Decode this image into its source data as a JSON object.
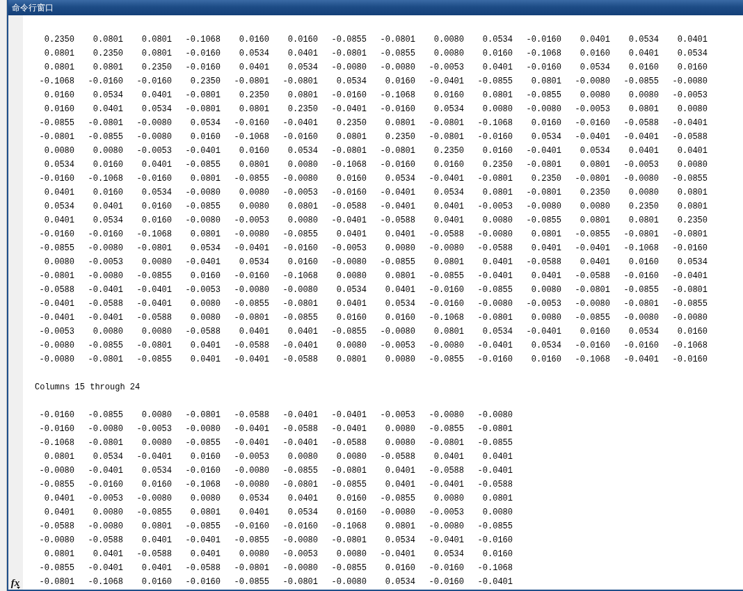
{
  "window": {
    "title": "命令行窗口"
  },
  "function_button": {
    "label": "fx"
  },
  "blocks": [
    {
      "kind": "matrix",
      "rows": [
        [
          "0.2350",
          "0.0801",
          "0.0801",
          "-0.1068",
          "0.0160",
          "0.0160",
          "-0.0855",
          "-0.0801",
          "0.0080",
          "0.0534",
          "-0.0160",
          "0.0401",
          "0.0534",
          "0.0401"
        ],
        [
          "0.0801",
          "0.2350",
          "0.0801",
          "-0.0160",
          "0.0534",
          "0.0401",
          "-0.0801",
          "-0.0855",
          "0.0080",
          "0.0160",
          "-0.1068",
          "0.0160",
          "0.0401",
          "0.0534"
        ],
        [
          "0.0801",
          "0.0801",
          "0.2350",
          "-0.0160",
          "0.0401",
          "0.0534",
          "-0.0080",
          "-0.0080",
          "-0.0053",
          "0.0401",
          "-0.0160",
          "0.0534",
          "0.0160",
          "0.0160"
        ],
        [
          "-0.1068",
          "-0.0160",
          "-0.0160",
          "0.2350",
          "-0.0801",
          "-0.0801",
          "0.0534",
          "0.0160",
          "-0.0401",
          "-0.0855",
          "0.0801",
          "-0.0080",
          "-0.0855",
          "-0.0080"
        ],
        [
          "0.0160",
          "0.0534",
          "0.0401",
          "-0.0801",
          "0.2350",
          "0.0801",
          "-0.0160",
          "-0.1068",
          "0.0160",
          "0.0801",
          "-0.0855",
          "0.0080",
          "0.0080",
          "-0.0053"
        ],
        [
          "0.0160",
          "0.0401",
          "0.0534",
          "-0.0801",
          "0.0801",
          "0.2350",
          "-0.0401",
          "-0.0160",
          "0.0534",
          "0.0080",
          "-0.0080",
          "-0.0053",
          "0.0801",
          "0.0080"
        ],
        [
          "-0.0855",
          "-0.0801",
          "-0.0080",
          "0.0534",
          "-0.0160",
          "-0.0401",
          "0.2350",
          "0.0801",
          "-0.0801",
          "-0.1068",
          "0.0160",
          "-0.0160",
          "-0.0588",
          "-0.0401"
        ],
        [
          "-0.0801",
          "-0.0855",
          "-0.0080",
          "0.0160",
          "-0.1068",
          "-0.0160",
          "0.0801",
          "0.2350",
          "-0.0801",
          "-0.0160",
          "0.0534",
          "-0.0401",
          "-0.0401",
          "-0.0588"
        ],
        [
          "0.0080",
          "0.0080",
          "-0.0053",
          "-0.0401",
          "0.0160",
          "0.0534",
          "-0.0801",
          "-0.0801",
          "0.2350",
          "0.0160",
          "-0.0401",
          "0.0534",
          "0.0401",
          "0.0401"
        ],
        [
          "0.0534",
          "0.0160",
          "0.0401",
          "-0.0855",
          "0.0801",
          "0.0080",
          "-0.1068",
          "-0.0160",
          "0.0160",
          "0.2350",
          "-0.0801",
          "0.0801",
          "-0.0053",
          "0.0080"
        ],
        [
          "-0.0160",
          "-0.1068",
          "-0.0160",
          "0.0801",
          "-0.0855",
          "-0.0080",
          "0.0160",
          "0.0534",
          "-0.0401",
          "-0.0801",
          "0.2350",
          "-0.0801",
          "-0.0080",
          "-0.0855"
        ],
        [
          "0.0401",
          "0.0160",
          "0.0534",
          "-0.0080",
          "0.0080",
          "-0.0053",
          "-0.0160",
          "-0.0401",
          "0.0534",
          "0.0801",
          "-0.0801",
          "0.2350",
          "0.0080",
          "0.0801"
        ],
        [
          "0.0534",
          "0.0401",
          "0.0160",
          "-0.0855",
          "0.0080",
          "0.0801",
          "-0.0588",
          "-0.0401",
          "0.0401",
          "-0.0053",
          "-0.0080",
          "0.0080",
          "0.2350",
          "0.0801"
        ],
        [
          "0.0401",
          "0.0534",
          "0.0160",
          "-0.0080",
          "-0.0053",
          "0.0080",
          "-0.0401",
          "-0.0588",
          "0.0401",
          "0.0080",
          "-0.0855",
          "0.0801",
          "0.0801",
          "0.2350"
        ],
        [
          "-0.0160",
          "-0.0160",
          "-0.1068",
          "0.0801",
          "-0.0080",
          "-0.0855",
          "0.0401",
          "0.0401",
          "-0.0588",
          "-0.0080",
          "0.0801",
          "-0.0855",
          "-0.0801",
          "-0.0801"
        ],
        [
          "-0.0855",
          "-0.0080",
          "-0.0801",
          "0.0534",
          "-0.0401",
          "-0.0160",
          "-0.0053",
          "0.0080",
          "-0.0080",
          "-0.0588",
          "0.0401",
          "-0.0401",
          "-0.1068",
          "-0.0160"
        ],
        [
          "0.0080",
          "-0.0053",
          "0.0080",
          "-0.0401",
          "0.0534",
          "0.0160",
          "-0.0080",
          "-0.0855",
          "0.0801",
          "0.0401",
          "-0.0588",
          "0.0401",
          "0.0160",
          "0.0534"
        ],
        [
          "-0.0801",
          "-0.0080",
          "-0.0855",
          "0.0160",
          "-0.0160",
          "-0.1068",
          "0.0080",
          "0.0801",
          "-0.0855",
          "-0.0401",
          "0.0401",
          "-0.0588",
          "-0.0160",
          "-0.0401"
        ],
        [
          "-0.0588",
          "-0.0401",
          "-0.0401",
          "-0.0053",
          "-0.0080",
          "-0.0080",
          "0.0534",
          "0.0401",
          "-0.0160",
          "-0.0855",
          "0.0080",
          "-0.0801",
          "-0.0855",
          "-0.0801"
        ],
        [
          "-0.0401",
          "-0.0588",
          "-0.0401",
          "0.0080",
          "-0.0855",
          "-0.0801",
          "0.0401",
          "0.0534",
          "-0.0160",
          "-0.0080",
          "-0.0053",
          "-0.0080",
          "-0.0801",
          "-0.0855"
        ],
        [
          "-0.0401",
          "-0.0401",
          "-0.0588",
          "0.0080",
          "-0.0801",
          "-0.0855",
          "0.0160",
          "0.0160",
          "-0.1068",
          "-0.0801",
          "0.0080",
          "-0.0855",
          "-0.0080",
          "-0.0080"
        ],
        [
          "-0.0053",
          "0.0080",
          "0.0080",
          "-0.0588",
          "0.0401",
          "0.0401",
          "-0.0855",
          "-0.0080",
          "0.0801",
          "0.0534",
          "-0.0401",
          "0.0160",
          "0.0534",
          "0.0160"
        ],
        [
          "-0.0080",
          "-0.0855",
          "-0.0801",
          "0.0401",
          "-0.0588",
          "-0.0401",
          "0.0080",
          "-0.0053",
          "-0.0080",
          "-0.0401",
          "0.0534",
          "-0.0160",
          "-0.0160",
          "-0.1068"
        ],
        [
          "-0.0080",
          "-0.0801",
          "-0.0855",
          "0.0401",
          "-0.0401",
          "-0.0588",
          "0.0801",
          "0.0080",
          "-0.0855",
          "-0.0160",
          "0.0160",
          "-0.1068",
          "-0.0401",
          "-0.0160"
        ]
      ]
    },
    {
      "kind": "text",
      "text": "Columns 15 through 24"
    },
    {
      "kind": "matrix",
      "rows": [
        [
          "-0.0160",
          "-0.0855",
          "0.0080",
          "-0.0801",
          "-0.0588",
          "-0.0401",
          "-0.0401",
          "-0.0053",
          "-0.0080",
          "-0.0080"
        ],
        [
          "-0.0160",
          "-0.0080",
          "-0.0053",
          "-0.0080",
          "-0.0401",
          "-0.0588",
          "-0.0401",
          "0.0080",
          "-0.0855",
          "-0.0801"
        ],
        [
          "-0.1068",
          "-0.0801",
          "0.0080",
          "-0.0855",
          "-0.0401",
          "-0.0401",
          "-0.0588",
          "0.0080",
          "-0.0801",
          "-0.0855"
        ],
        [
          "0.0801",
          "0.0534",
          "-0.0401",
          "0.0160",
          "-0.0053",
          "0.0080",
          "0.0080",
          "-0.0588",
          "0.0401",
          "0.0401"
        ],
        [
          "-0.0080",
          "-0.0401",
          "0.0534",
          "-0.0160",
          "-0.0080",
          "-0.0855",
          "-0.0801",
          "0.0401",
          "-0.0588",
          "-0.0401"
        ],
        [
          "-0.0855",
          "-0.0160",
          "0.0160",
          "-0.1068",
          "-0.0080",
          "-0.0801",
          "-0.0855",
          "0.0401",
          "-0.0401",
          "-0.0588"
        ],
        [
          "0.0401",
          "-0.0053",
          "-0.0080",
          "0.0080",
          "0.0534",
          "0.0401",
          "0.0160",
          "-0.0855",
          "0.0080",
          "0.0801"
        ],
        [
          "0.0401",
          "0.0080",
          "-0.0855",
          "0.0801",
          "0.0401",
          "0.0534",
          "0.0160",
          "-0.0080",
          "-0.0053",
          "0.0080"
        ],
        [
          "-0.0588",
          "-0.0080",
          "0.0801",
          "-0.0855",
          "-0.0160",
          "-0.0160",
          "-0.1068",
          "0.0801",
          "-0.0080",
          "-0.0855"
        ],
        [
          "-0.0080",
          "-0.0588",
          "0.0401",
          "-0.0401",
          "-0.0855",
          "-0.0080",
          "-0.0801",
          "0.0534",
          "-0.0401",
          "-0.0160"
        ],
        [
          "0.0801",
          "0.0401",
          "-0.0588",
          "0.0401",
          "0.0080",
          "-0.0053",
          "0.0080",
          "-0.0401",
          "0.0534",
          "0.0160"
        ],
        [
          "-0.0855",
          "-0.0401",
          "0.0401",
          "-0.0588",
          "-0.0801",
          "-0.0080",
          "-0.0855",
          "0.0160",
          "-0.0160",
          "-0.1068"
        ],
        [
          "-0.0801",
          "-0.1068",
          "0.0160",
          "-0.0160",
          "-0.0855",
          "-0.0801",
          "-0.0080",
          "0.0534",
          "-0.0160",
          "-0.0401"
        ]
      ]
    }
  ]
}
